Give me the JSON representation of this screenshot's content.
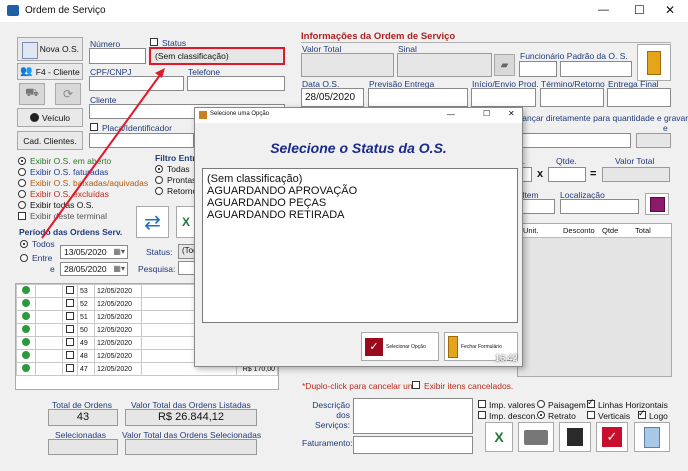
{
  "window": {
    "title": "Ordem de Serviço",
    "minimize": "—",
    "maximize": "☐",
    "close": "✕"
  },
  "left_buttons": {
    "nova_os": "Nova O.S.",
    "cliente": "F4 - Cliente",
    "veiculo": "Veículo",
    "cad_clientes": "Cad. Clientes."
  },
  "fields": {
    "numero_label": "Número",
    "status_label": "Status",
    "status_value": "(Sem classificação)",
    "cpf_label": "CPF/CNPJ",
    "telefone_label": "Telefone",
    "cliente_label": "Cliente",
    "placa_label": "Placa/Identificador"
  },
  "filters": {
    "items": [
      "Exibir O.S. em aberto",
      "Exibir O.S. faturadas",
      "Exibir O.S. baixadas/aquivadas",
      "Exibir O.S. excluídas",
      "Exibir todas O.S.",
      "Exibir deste terminal"
    ],
    "filtro_entrega_title": "Filtro Entre",
    "filtro_entrega_options": [
      "Todas",
      "Prontas",
      "Retorno"
    ],
    "periodo_title": "Período das Ordens Serv.",
    "periodo_todos": "Todos",
    "periodo_entre": "Entre",
    "periodo_e": "e",
    "date_from": "13/05/2020",
    "date_to": "28/05/2020",
    "status_label": "Status:",
    "status_value": "(Tod",
    "pesquisa_label": "Pesquisa:"
  },
  "orders": [
    {
      "num": "53",
      "date": "12/05/2020",
      "value": ""
    },
    {
      "num": "52",
      "date": "12/05/2020",
      "value": ""
    },
    {
      "num": "51",
      "date": "12/05/2020",
      "value": ""
    },
    {
      "num": "50",
      "date": "12/05/2020",
      "value": ""
    },
    {
      "num": "49",
      "date": "12/05/2020",
      "value": "R$ 170,00"
    },
    {
      "num": "48",
      "date": "12/05/2020",
      "value": "R$ 170,00"
    },
    {
      "num": "47",
      "date": "12/05/2020",
      "value": "R$ 170,00"
    }
  ],
  "totals": {
    "total_ordens_label": "Total de Ordens",
    "total_ordens_value": "43",
    "valor_total_label": "Valor Total das Ordens Listadas",
    "valor_total_value": "R$ 26.844,12",
    "selecionadas_label": "Selecionadas",
    "valor_selecionadas_label": "Valor Total das Ordens Selecionadas"
  },
  "info": {
    "section_title": "Informações da Ordem de Serviço",
    "valor_total_label": "Valor Total",
    "sinal_label": "Sinal",
    "funcionario_label": "Funcionário Padrão da O. S.",
    "data_os_label": "Data O.S.",
    "data_os_value": "28/05/2020",
    "previsao_label": "Previsão Entrega",
    "inicio_label": "Início/Envio Prod.",
    "termino_label": "Término/Retorno",
    "entrega_final_label": "Entrega Final",
    "avancar_text": "vançar diretamente para quantidade e gravar",
    "avancar_e": "e",
    "qtde_label": "Qtde.",
    "x_sign": "x",
    "eq_sign": "=",
    "valor_total2_label": "Valor Total",
    "n_label": "n.",
    "item_label": "o Item",
    "localizacao_label": "Localização"
  },
  "items_table": {
    "headers": [
      "Unit.",
      "Desconto",
      "Qtde",
      "Total"
    ]
  },
  "bottom": {
    "cancel_text": "*Duplo-click para cancelar um",
    "exibir_cancelados": "Exibir itens cancelados.",
    "descricao_label": "Descrição dos Serviços:",
    "faturamento_label": "Faturamento:",
    "imp_valores": "Imp. valores",
    "paisagem": "Paisagem",
    "linhas_horizontais": "Linhas Horizontais",
    "imp_descon": "Imp. descon.",
    "retrato": "Retrato",
    "verticais": "Verticais",
    "logo": "Logo"
  },
  "modal": {
    "title": "Selecione uma Opção",
    "heading": "Selecione o Status da O.S.",
    "options": [
      "(Sem classificação)",
      "AGUARDANDO APROVAÇÃO",
      "AGUARDANDO PEÇAS",
      "AGUARDANDO RETIRADA"
    ],
    "select_btn": "Selecionar Opção",
    "close_btn": "Fechar Formulário",
    "clock": "16:42",
    "minimize": "—",
    "maximize": "☐",
    "close": "✕"
  }
}
